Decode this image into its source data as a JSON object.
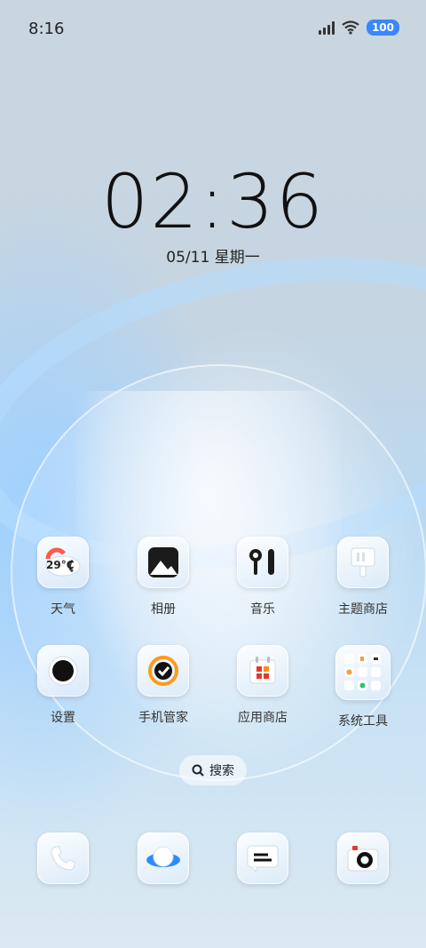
{
  "status_bar": {
    "time": "8:16",
    "battery": "100"
  },
  "lockscreen": {
    "clock": "02:36",
    "date": "05/11 星期一"
  },
  "apps": [
    {
      "label": "天气",
      "icon": "weather-icon",
      "temp": "29°C"
    },
    {
      "label": "相册",
      "icon": "gallery-icon"
    },
    {
      "label": "音乐",
      "icon": "music-icon"
    },
    {
      "label": "主题商店",
      "icon": "theme-store-icon"
    },
    {
      "label": "设置",
      "icon": "settings-icon"
    },
    {
      "label": "手机管家",
      "icon": "phone-manager-icon"
    },
    {
      "label": "应用商店",
      "icon": "app-store-icon"
    },
    {
      "label": "系统工具",
      "icon": "system-tools-folder-icon"
    }
  ],
  "search": {
    "label": "搜索"
  },
  "dock": [
    {
      "icon": "phone-icon"
    },
    {
      "icon": "browser-icon"
    },
    {
      "icon": "messages-icon"
    },
    {
      "icon": "camera-icon"
    }
  ]
}
